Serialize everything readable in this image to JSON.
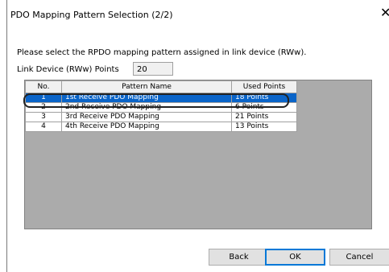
{
  "dialog": {
    "title": "PDO Mapping Pattern Selection (2/2)",
    "close_glyph": "✕",
    "prompt": "Please select the RPDO mapping pattern assigned in link device (RWw).",
    "points_label": "Link Device (RWw) Points",
    "points_value": "20"
  },
  "table": {
    "headers": {
      "no": "No.",
      "name": "Pattern Name",
      "used": "Used Points"
    },
    "rows": [
      {
        "no": "1",
        "name": "1st Receive PDO Mapping",
        "used": "18 Points",
        "selected": true
      },
      {
        "no": "2",
        "name": "2nd Receive PDO Mapping",
        "used": "6 Points",
        "selected": false
      },
      {
        "no": "3",
        "name": "3rd Receive PDO Mapping",
        "used": "21 Points",
        "selected": false
      },
      {
        "no": "4",
        "name": "4th Receive PDO Mapping",
        "used": "13 Points",
        "selected": false
      }
    ]
  },
  "buttons": {
    "back": "Back",
    "ok": "OK",
    "cancel": "Cancel"
  },
  "colors": {
    "selection": "#0a64c8",
    "grid_background": "#ababab"
  }
}
